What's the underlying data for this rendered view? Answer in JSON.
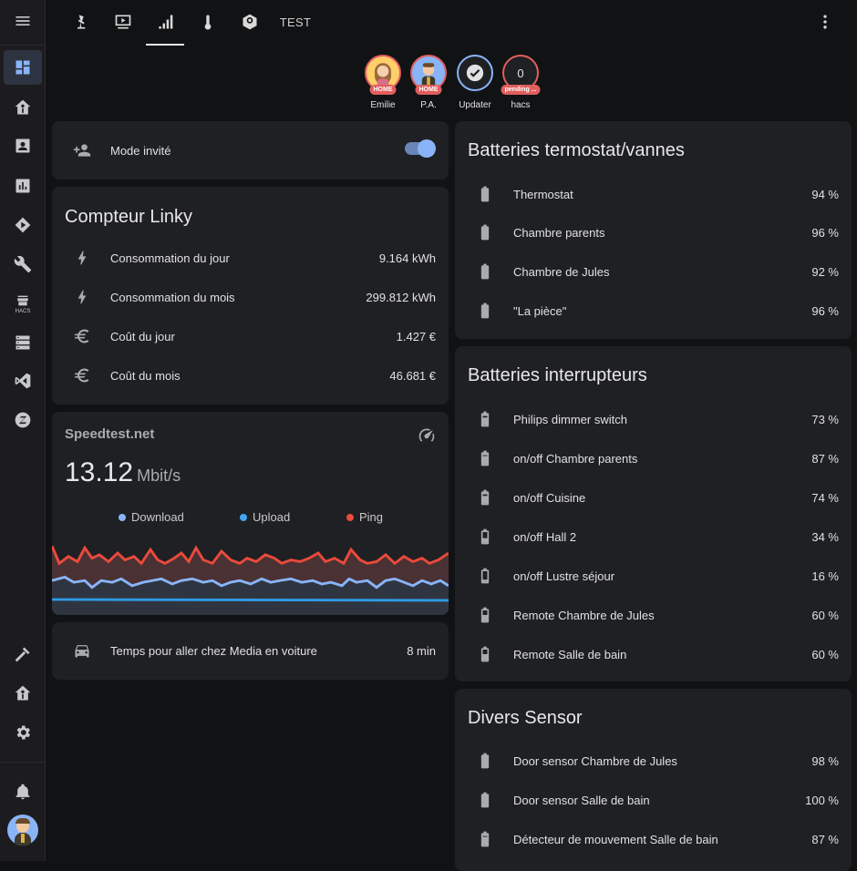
{
  "sidebar": {
    "items": [
      {
        "icon": "menu-icon"
      },
      {
        "icon": "dashboard-icon",
        "active": true
      },
      {
        "icon": "home-assistant-icon"
      },
      {
        "icon": "account-box-icon"
      },
      {
        "icon": "chart-box-icon"
      },
      {
        "icon": "play-box-icon"
      },
      {
        "icon": "wrench-icon"
      },
      {
        "icon": "store-icon",
        "caption": "HACS"
      },
      {
        "icon": "server-icon"
      },
      {
        "icon": "vscode-icon"
      },
      {
        "icon": "zigbee-icon"
      },
      {
        "icon": "hammer-icon"
      },
      {
        "icon": "home-assistant-icon"
      },
      {
        "icon": "cog-icon"
      },
      {
        "icon": "bell-icon"
      },
      {
        "icon": "avatar"
      }
    ]
  },
  "topbar": {
    "tabs": [
      {
        "icon": "lamp-icon"
      },
      {
        "icon": "monitor-play-icon"
      },
      {
        "icon": "signal-icon",
        "active": true
      },
      {
        "icon": "thermometer-icon"
      },
      {
        "icon": "robot-vacuum-icon"
      },
      {
        "label": "TEST"
      }
    ],
    "menu_icon": "dots-vertical-icon"
  },
  "badges": [
    {
      "label": "Emilie",
      "tag": "HOME"
    },
    {
      "label": "P.A.",
      "tag": "HOME"
    },
    {
      "label": "Updater"
    },
    {
      "label": "hacs",
      "value": "0",
      "tag": "pending ..."
    }
  ],
  "guest_card": {
    "label": "Mode invité",
    "toggle_on": true
  },
  "linky": {
    "title": "Compteur Linky",
    "rows": [
      {
        "name": "Consommation du jour",
        "value": "9.164 kWh",
        "icon": "flash-icon"
      },
      {
        "name": "Consommation du mois",
        "value": "299.812 kWh",
        "icon": "flash-icon"
      },
      {
        "name": "Coût du jour",
        "value": "1.427 €",
        "icon": "euro-icon"
      },
      {
        "name": "Coût du mois",
        "value": "46.681 €",
        "icon": "euro-icon"
      }
    ]
  },
  "speedtest": {
    "title": "Speedtest.net",
    "value": "13.12",
    "unit": "Mbit/s",
    "legend": [
      {
        "label": "Download",
        "color": "#8ab4f8"
      },
      {
        "label": "Upload",
        "color": "#42a5f5"
      },
      {
        "label": "Ping",
        "color": "#ea4a3c"
      }
    ]
  },
  "commute": {
    "name": "Temps pour aller chez Media en voiture",
    "value": "8 min"
  },
  "batteries_thermostat": {
    "title": "Batteries termostat/vannes",
    "rows": [
      {
        "name": "Thermostat",
        "value": "94 %"
      },
      {
        "name": "Chambre parents",
        "value": "96 %"
      },
      {
        "name": "Chambre de Jules",
        "value": "92 %"
      },
      {
        "name": "\"La pièce\"",
        "value": "96 %"
      }
    ]
  },
  "batteries_switches": {
    "title": "Batteries interrupteurs",
    "rows": [
      {
        "name": "Philips dimmer switch",
        "value": "73 %"
      },
      {
        "name": "on/off Chambre parents",
        "value": "87 %"
      },
      {
        "name": "on/off Cuisine",
        "value": "74 %"
      },
      {
        "name": "on/off Hall 2",
        "value": "34 %"
      },
      {
        "name": "on/off Lustre séjour",
        "value": "16 %"
      },
      {
        "name": "Remote Chambre de Jules",
        "value": "60 %"
      },
      {
        "name": "Remote Salle de bain",
        "value": "60 %"
      }
    ]
  },
  "divers": {
    "title": "Divers Sensor",
    "rows": [
      {
        "name": "Door sensor Chambre de Jules",
        "value": "98 %"
      },
      {
        "name": "Door sensor Salle de bain",
        "value": "100 %"
      },
      {
        "name": "Détecteur de mouvement Salle de bain",
        "value": "87 %"
      }
    ]
  }
}
